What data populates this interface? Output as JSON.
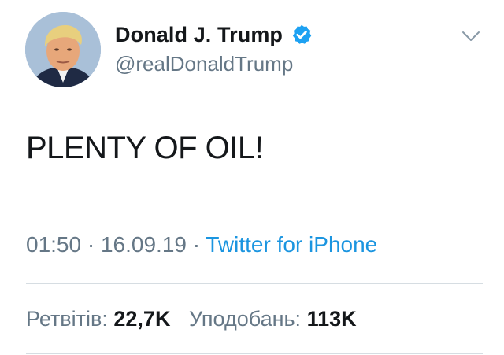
{
  "user": {
    "display_name": "Donald J. Trump",
    "handle": "@realDonaldTrump",
    "verified": true
  },
  "tweet": {
    "text": "PLENTY OF OIL!",
    "time": "01:50",
    "separator1": " · ",
    "date": "16.09.19",
    "separator2": " · ",
    "source": "Twitter for iPhone"
  },
  "stats": {
    "retweets_label": "Ретвітів:",
    "retweets_value": "22,7K",
    "likes_label": "Уподобань:",
    "likes_value": "113K"
  },
  "icons": {
    "verified": "verified-badge-icon",
    "menu": "chevron-down-icon"
  },
  "colors": {
    "accent": "#1b95e0",
    "text_primary": "#14171a",
    "text_secondary": "#657786",
    "divider": "#d6dde2"
  }
}
